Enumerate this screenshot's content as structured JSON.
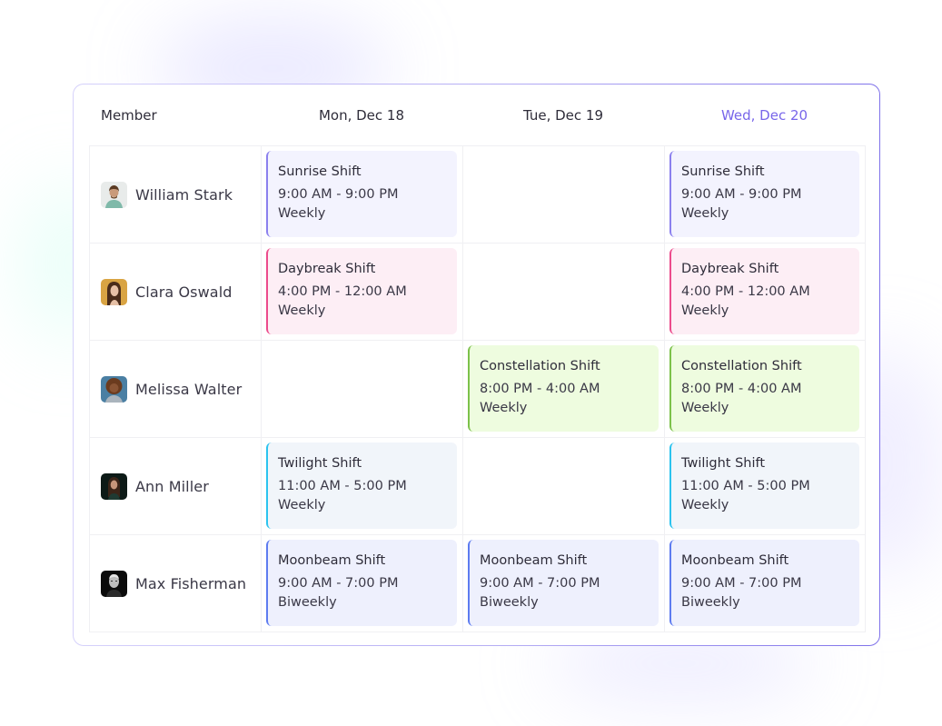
{
  "header": {
    "member_label": "Member",
    "days": [
      {
        "label": "Mon, Dec 18",
        "today": false
      },
      {
        "label": "Tue, Dec 19",
        "today": false
      },
      {
        "label": "Wed, Dec 20",
        "today": true
      }
    ]
  },
  "colors": {
    "accent": "#7866ea",
    "sunrise": {
      "bg": "#f3f3fe",
      "bar": "#8b80ee"
    },
    "daybreak": {
      "bg": "#fdeef5",
      "bar": "#ec4b8c"
    },
    "constellation": {
      "bg": "#eefcdf",
      "bar": "#7cc14a"
    },
    "twilight": {
      "bg": "#f1f5fa",
      "bar": "#2bc3ef"
    },
    "moonbeam": {
      "bg": "#eef0fd",
      "bar": "#5d7bf0"
    }
  },
  "members": [
    {
      "name": "William Stark",
      "avatar": "avatar-william-stark",
      "shifts": [
        {
          "name": "Sunrise Shift",
          "time": "9:00 AM - 9:00 PM",
          "recurrence": "Weekly",
          "type": "sunrise"
        },
        null,
        {
          "name": "Sunrise Shift",
          "time": "9:00 AM - 9:00 PM",
          "recurrence": "Weekly",
          "type": "sunrise"
        }
      ]
    },
    {
      "name": "Clara Oswald",
      "avatar": "avatar-clara-oswald",
      "shifts": [
        {
          "name": "Daybreak Shift",
          "time": "4:00 PM - 12:00 AM",
          "recurrence": "Weekly",
          "type": "daybreak"
        },
        null,
        {
          "name": "Daybreak Shift",
          "time": "4:00 PM - 12:00 AM",
          "recurrence": "Weekly",
          "type": "daybreak"
        }
      ]
    },
    {
      "name": "Melissa Walter",
      "avatar": "avatar-melissa-walter",
      "shifts": [
        null,
        {
          "name": "Constellation Shift",
          "time": "8:00 PM - 4:00 AM",
          "recurrence": "Weekly",
          "type": "constellation"
        },
        {
          "name": "Constellation Shift",
          "time": "8:00 PM - 4:00 AM",
          "recurrence": "Weekly",
          "type": "constellation"
        }
      ]
    },
    {
      "name": "Ann Miller",
      "avatar": "avatar-ann-miller",
      "shifts": [
        {
          "name": "Twilight Shift",
          "time": "11:00 AM - 5:00 PM",
          "recurrence": "Weekly",
          "type": "twilight"
        },
        null,
        {
          "name": "Twilight Shift",
          "time": "11:00 AM - 5:00 PM",
          "recurrence": "Weekly",
          "type": "twilight"
        }
      ]
    },
    {
      "name": "Max Fisherman",
      "avatar": "avatar-max-fisherman",
      "shifts": [
        {
          "name": "Moonbeam Shift",
          "time": "9:00 AM - 7:00 PM",
          "recurrence": "Biweekly",
          "type": "moonbeam"
        },
        {
          "name": "Moonbeam Shift",
          "time": "9:00 AM - 7:00 PM",
          "recurrence": "Biweekly",
          "type": "moonbeam"
        },
        {
          "name": "Moonbeam Shift",
          "time": "9:00 AM - 7:00 PM",
          "recurrence": "Biweekly",
          "type": "moonbeam"
        }
      ]
    }
  ]
}
